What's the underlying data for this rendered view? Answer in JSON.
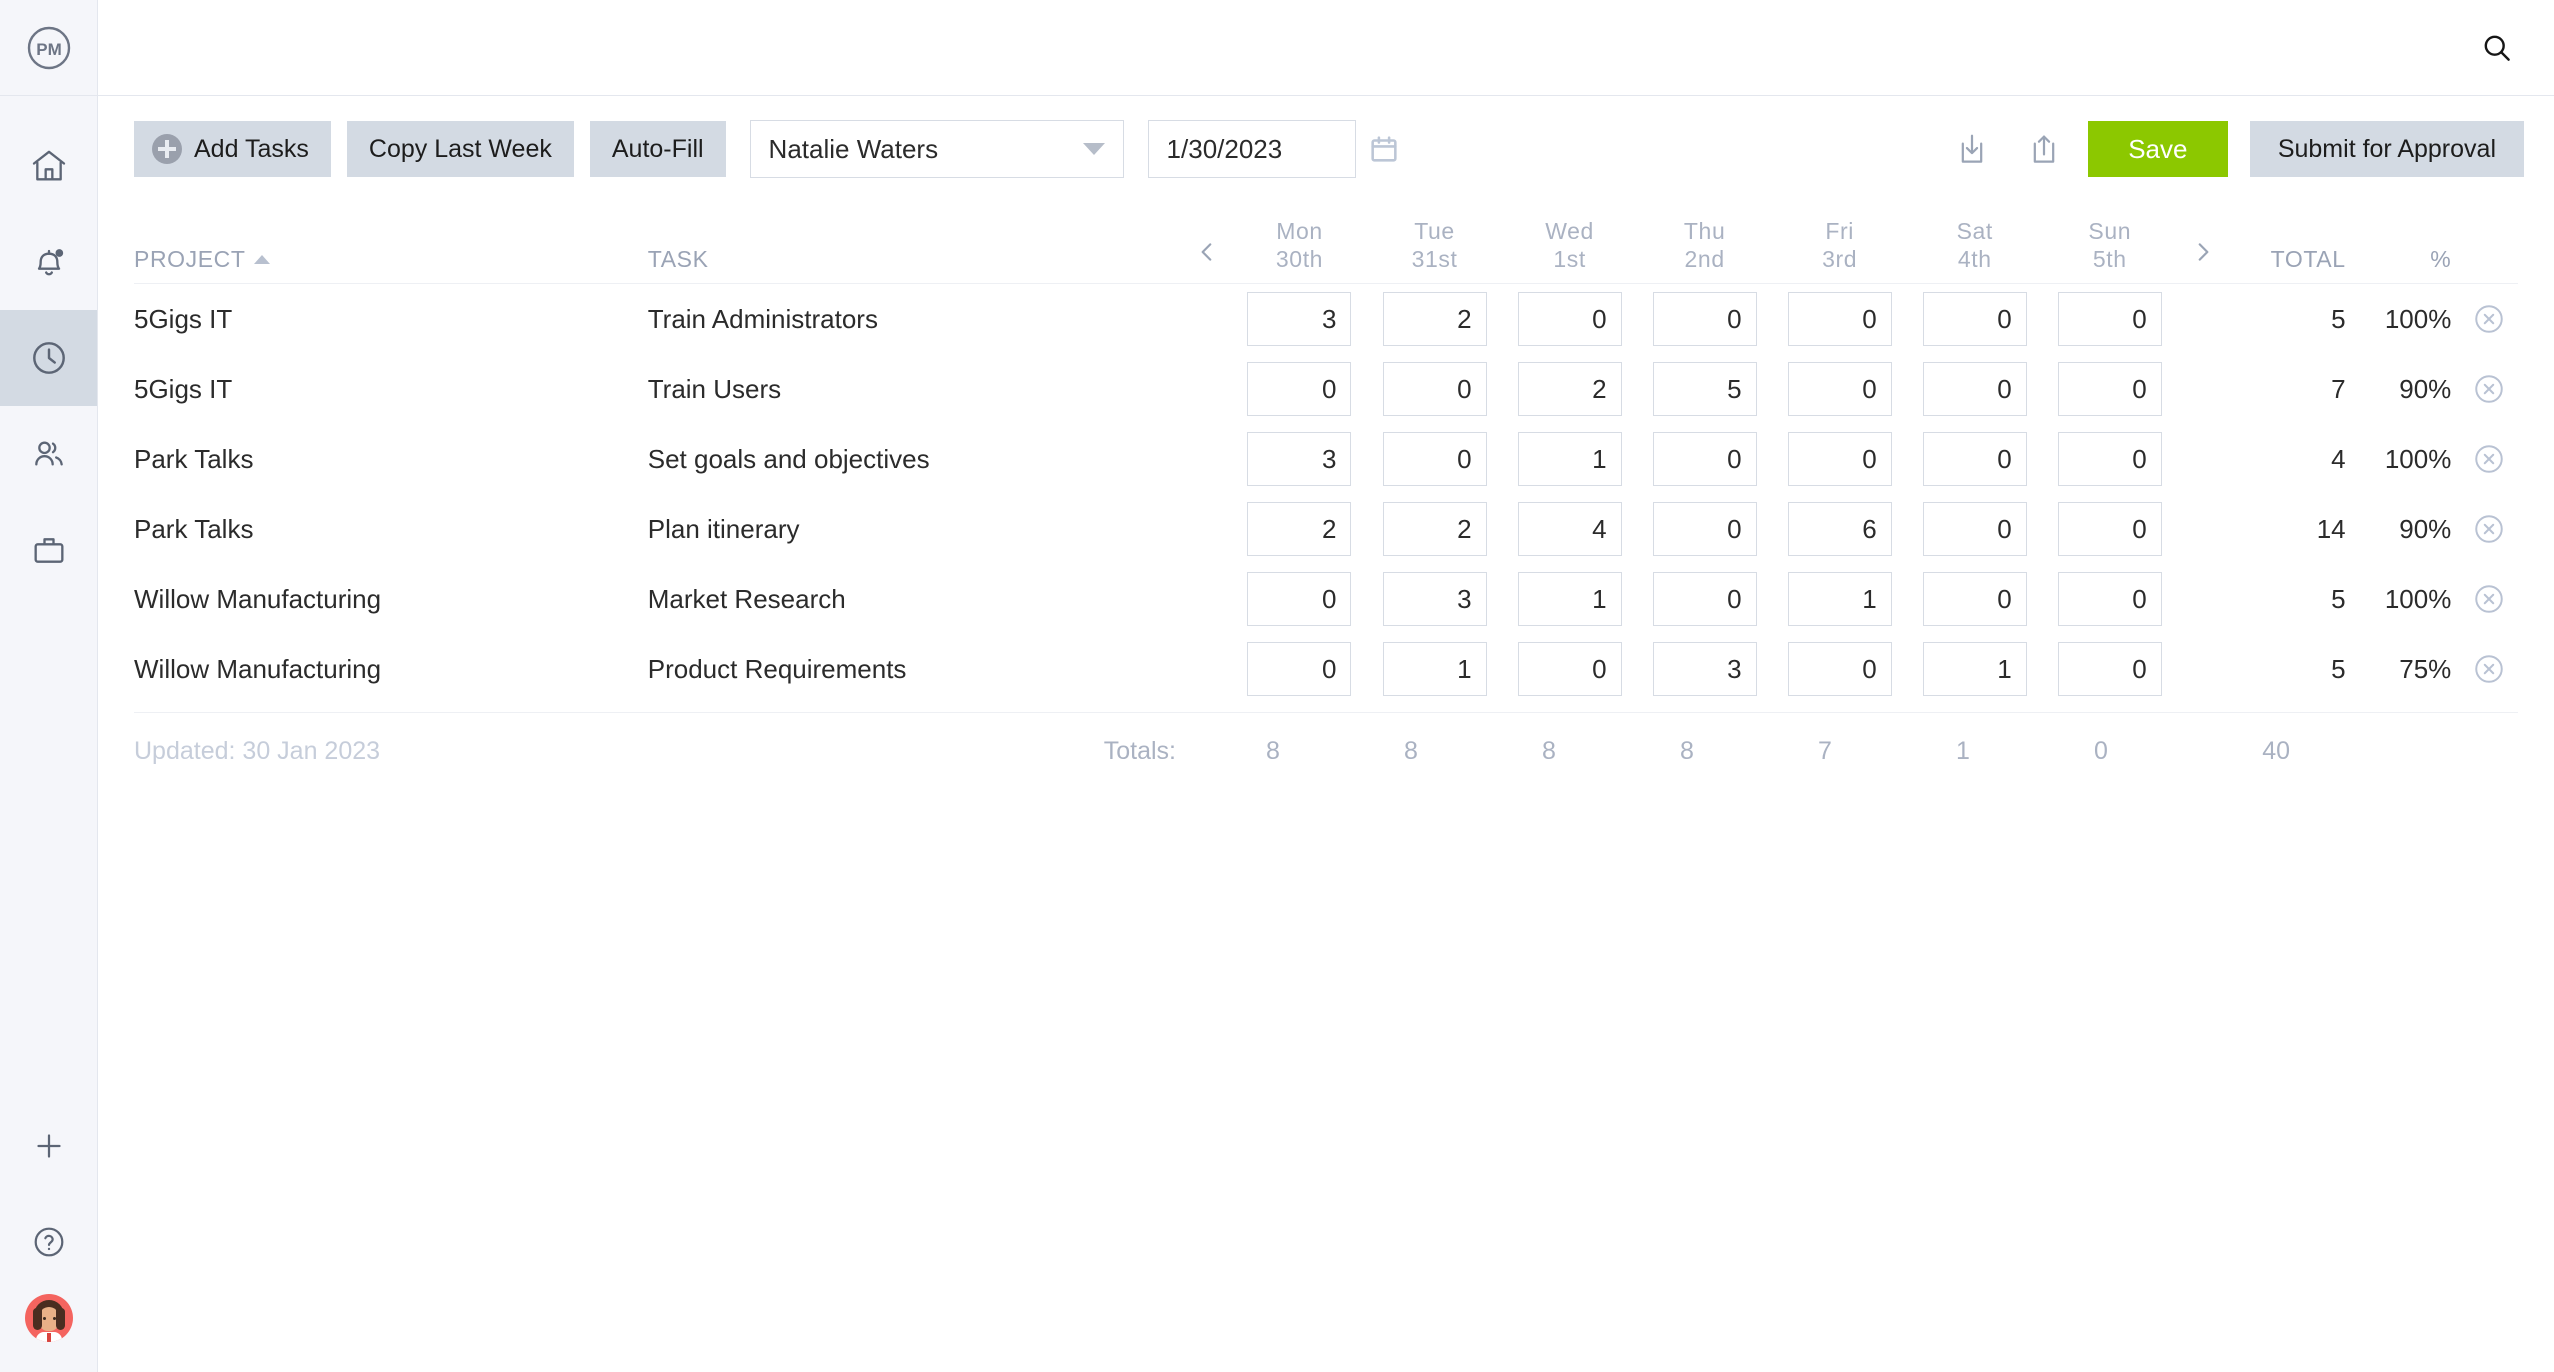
{
  "sidebar": {
    "logo_text": "PM",
    "items": [
      {
        "name": "home",
        "label": "Home",
        "active": false
      },
      {
        "name": "notifications",
        "label": "Notifications",
        "active": false
      },
      {
        "name": "timesheets",
        "label": "Timesheets",
        "active": true
      },
      {
        "name": "team",
        "label": "Team",
        "active": false
      },
      {
        "name": "projects",
        "label": "Projects",
        "active": false
      }
    ],
    "bottom": [
      {
        "name": "add",
        "label": "Add"
      },
      {
        "name": "help",
        "label": "Help"
      }
    ]
  },
  "topbar": {
    "search_icon": "search-icon"
  },
  "toolbar": {
    "add_tasks_label": "Add Tasks",
    "copy_last_week_label": "Copy Last Week",
    "auto_fill_label": "Auto-Fill",
    "user_select_value": "Natalie Waters",
    "date_value": "1/30/2023",
    "calendar_icon": "calendar-icon",
    "download_icon": "download-icon",
    "share_icon": "share-icon",
    "save_label": "Save",
    "submit_label": "Submit for Approval",
    "save_color": "#8cc800",
    "button_bg": "#d3dae3"
  },
  "table": {
    "headers": {
      "project": "PROJECT",
      "task": "TASK",
      "total": "TOTAL",
      "percent": "%"
    },
    "days": [
      {
        "dow": "Mon",
        "date": "30th"
      },
      {
        "dow": "Tue",
        "date": "31st"
      },
      {
        "dow": "Wed",
        "date": "1st"
      },
      {
        "dow": "Thu",
        "date": "2nd"
      },
      {
        "dow": "Fri",
        "date": "3rd"
      },
      {
        "dow": "Sat",
        "date": "4th"
      },
      {
        "dow": "Sun",
        "date": "5th"
      }
    ],
    "rows": [
      {
        "project": "5Gigs IT",
        "task": "Train Administrators",
        "hours": [
          "3",
          "2",
          "0",
          "0",
          "0",
          "0",
          "0"
        ],
        "total": "5",
        "percent": "100%"
      },
      {
        "project": "5Gigs IT",
        "task": "Train Users",
        "hours": [
          "0",
          "0",
          "2",
          "5",
          "0",
          "0",
          "0"
        ],
        "total": "7",
        "percent": "90%"
      },
      {
        "project": "Park Talks",
        "task": "Set goals and objectives",
        "hours": [
          "3",
          "0",
          "1",
          "0",
          "0",
          "0",
          "0"
        ],
        "total": "4",
        "percent": "100%"
      },
      {
        "project": "Park Talks",
        "task": "Plan itinerary",
        "hours": [
          "2",
          "2",
          "4",
          "0",
          "6",
          "0",
          "0"
        ],
        "total": "14",
        "percent": "90%"
      },
      {
        "project": "Willow Manufacturing",
        "task": "Market Research",
        "hours": [
          "0",
          "3",
          "1",
          "0",
          "1",
          "0",
          "0"
        ],
        "total": "5",
        "percent": "100%"
      },
      {
        "project": "Willow Manufacturing",
        "task": "Product Requirements",
        "hours": [
          "0",
          "1",
          "0",
          "3",
          "0",
          "1",
          "0"
        ],
        "total": "5",
        "percent": "75%"
      }
    ],
    "footer": {
      "updated": "Updated: 30 Jan 2023",
      "totals_label": "Totals:",
      "day_totals": [
        "8",
        "8",
        "8",
        "8",
        "7",
        "1",
        "0"
      ],
      "grand_total": "40"
    }
  }
}
